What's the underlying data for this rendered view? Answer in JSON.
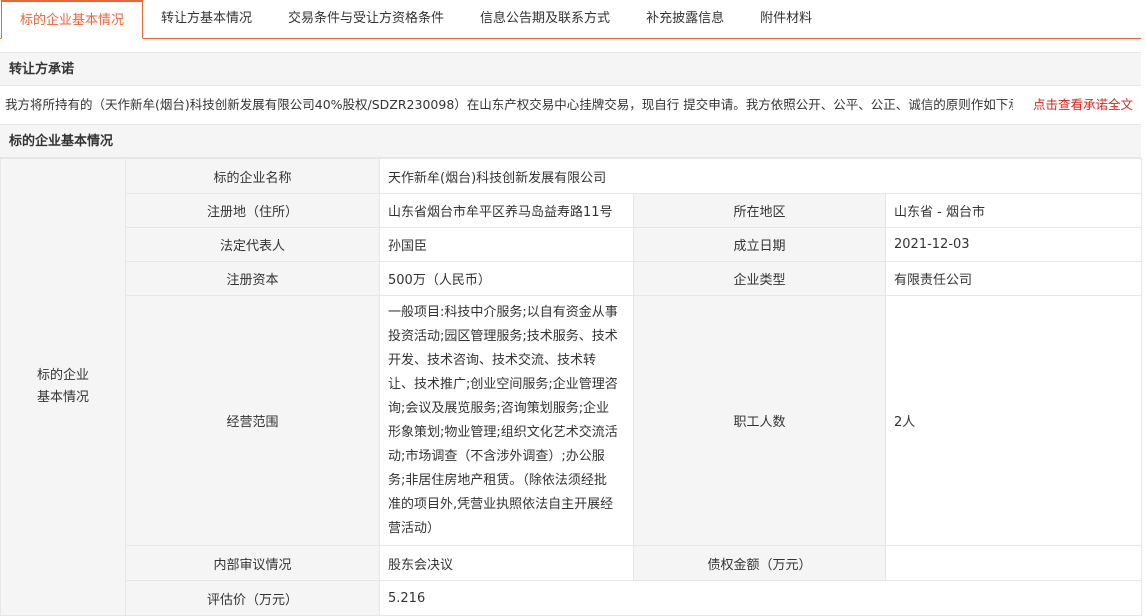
{
  "tabs": [
    {
      "label": "标的企业基本情况",
      "active": true
    },
    {
      "label": "转让方基本情况"
    },
    {
      "label": "交易条件与受让方资格条件"
    },
    {
      "label": "信息公告期及联系方式"
    },
    {
      "label": "补充披露信息"
    },
    {
      "label": "附件材料"
    }
  ],
  "commitment": {
    "title": "转让方承诺",
    "text": "我方将所持有的（天作新牟(烟台)科技创新发展有限公司40%股权/SDZR230098）在山东产权交易中心挂牌交易，现自行 提交申请。我方依照公开、公平、公正、诚信的原则作如下承诺",
    "link": "点击查看承诺全文"
  },
  "enterprise": {
    "section_title": "标的企业基本情况",
    "group_label": "标的企业\n基本情况",
    "name_label": "标的企业名称",
    "name": "天作新牟(烟台)科技创新发展有限公司",
    "address_label": "注册地（住所）",
    "address": "山东省烟台市牟平区养马岛益寿路11号",
    "region_label": "所在地区",
    "region": "山东省 - 烟台市",
    "rep_label": "法定代表人",
    "rep": "孙国臣",
    "date_label": "成立日期",
    "date": "2021-12-03",
    "capital_label": "注册资本",
    "capital": "500万（人民币）",
    "type_label": "企业类型",
    "type": "有限责任公司",
    "scope_label": "经营范围",
    "scope_lines": [
      "一般项目:科技中介服务;以自有资金从事",
      "投资活动;园区管理服务;技术服务、技术",
      "开发、技术咨询、技术交流、技术转",
      "让、技术推广;创业空间服务;企业管理咨",
      "询;会议及展览服务;咨询策划服务;企业",
      "形象策划;物业管理;组织文化艺术交流活",
      "动;市场调查（不含涉外调查）;办公服",
      "务;非居住房地产租赁。（除依法须经批",
      "准的项目外,凭营业执照依法自主开展经",
      "营活动）"
    ],
    "employees_label": "职工人数",
    "employees": "2人",
    "audit_label": "内部审议情况",
    "audit": "股东会决议",
    "debt_label": "债权金额（万元）",
    "debt": "",
    "valuation_label": "评估价（万元）",
    "valuation": "5.216"
  }
}
